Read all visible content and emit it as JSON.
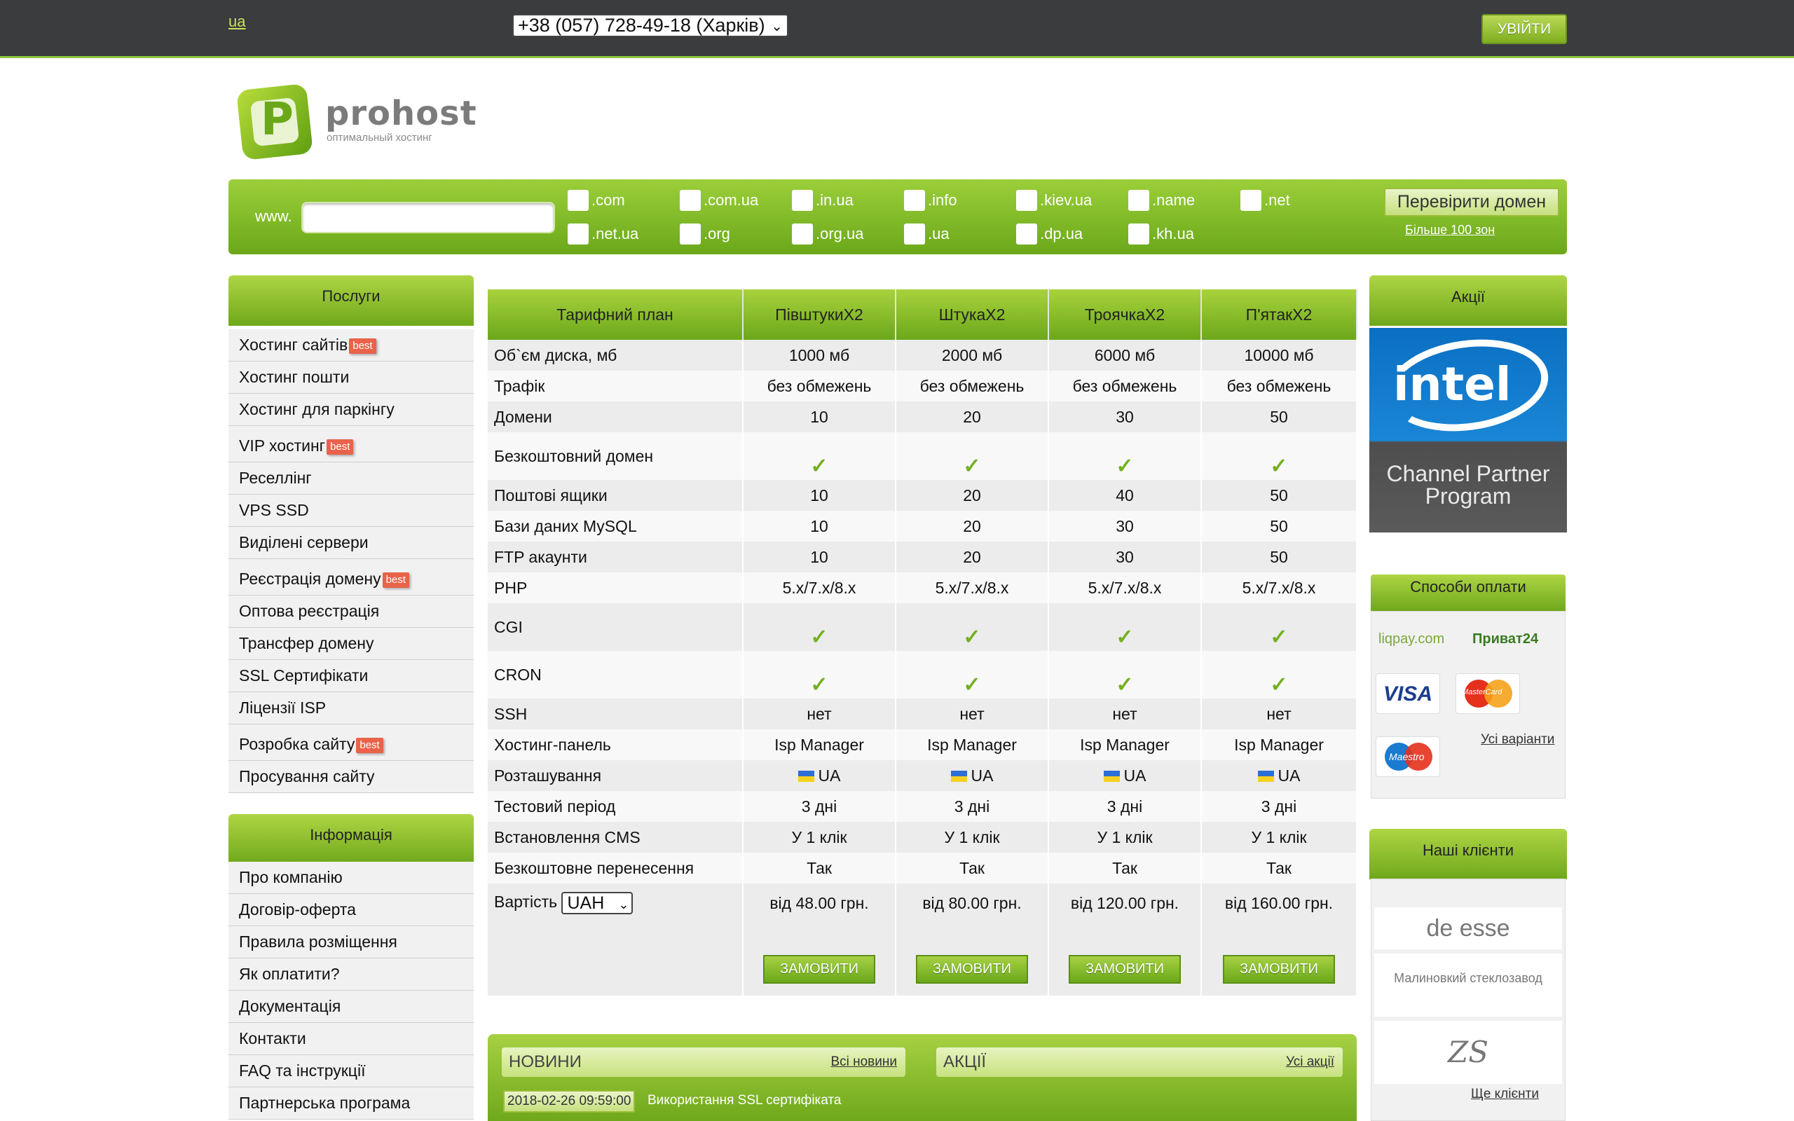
{
  "topbar": {
    "lang": "ua",
    "phone": "+38 (057) 728-49-18 (Харків)",
    "login": "УВІЙТИ"
  },
  "logo": {
    "name": "prohost",
    "tagline": "оптимальный хостинг"
  },
  "domain_search": {
    "prefix": "www.",
    "input_value": "",
    "zones_row1": [
      ".com",
      ".com.ua",
      ".in.ua",
      ".info",
      ".kiev.ua",
      ".name",
      ".net"
    ],
    "zones_row2": [
      ".net.ua",
      ".org",
      ".org.ua",
      ".ua",
      ".dp.ua",
      ".kh.ua"
    ],
    "check_button": "Перевірити домен",
    "more_zones": "Більше 100 зон"
  },
  "sidebar": {
    "services_title": "Послуги",
    "services": [
      {
        "label": "Хостинг сайтів",
        "badge": "best"
      },
      {
        "label": "Хостинг пошти",
        "badge": ""
      },
      {
        "label": "Хостинг для паркінгу",
        "badge": ""
      },
      {
        "label": "VIP хостинг",
        "badge": "best"
      },
      {
        "label": "Реселлінг",
        "badge": ""
      },
      {
        "label": "VPS SSD",
        "badge": ""
      },
      {
        "label": "Виділені сервери",
        "badge": ""
      },
      {
        "label": "Реєстрація домену",
        "badge": "best"
      },
      {
        "label": "Оптова реєстрація",
        "badge": ""
      },
      {
        "label": "Трансфер домену",
        "badge": ""
      },
      {
        "label": "SSL Сертифікати",
        "badge": ""
      },
      {
        "label": "Ліцензії ISP",
        "badge": ""
      },
      {
        "label": "Розробка сайту",
        "badge": "best"
      },
      {
        "label": "Просування сайту",
        "badge": ""
      }
    ],
    "info_title": "Інформація",
    "info": [
      "Про компанію",
      "Договір-оферта",
      "Правила розміщення",
      "Як оплатити?",
      "Документація",
      "Контакти",
      "FAQ та інструкції",
      "Партнерська програма"
    ]
  },
  "plans": {
    "header_label": "Тарифний план",
    "plan_names": [
      "ПівштукиX2",
      "ШтукаX2",
      "ТроячкаX2",
      "П'ятакX2"
    ],
    "rows": {
      "disk": {
        "label": "Об`єм диска, мб",
        "values": [
          "1000 мб",
          "2000 мб",
          "6000 мб",
          "10000 мб"
        ]
      },
      "traffic": {
        "label": "Трафік",
        "values": [
          "без обмежень",
          "без обмежень",
          "без обмежень",
          "без обмежень"
        ]
      },
      "domains": {
        "label": "Домени",
        "values": [
          "10",
          "20",
          "30",
          "50"
        ]
      },
      "free_domain": {
        "label": "Безкоштовний домен"
      },
      "mailboxes": {
        "label": "Поштові ящики",
        "values": [
          "10",
          "20",
          "40",
          "50"
        ]
      },
      "mysql": {
        "label": "Бази даних MySQL",
        "values": [
          "10",
          "20",
          "30",
          "50"
        ]
      },
      "ftp": {
        "label": "FTP акаунти",
        "values": [
          "10",
          "20",
          "30",
          "50"
        ]
      },
      "php": {
        "label": "PHP",
        "values": [
          "5.x/7.x/8.x",
          "5.x/7.x/8.x",
          "5.x/7.x/8.x",
          "5.x/7.x/8.x"
        ]
      },
      "cgi": {
        "label": "CGI"
      },
      "cron": {
        "label": "CRON"
      },
      "ssh": {
        "label": "SSH",
        "values": [
          "нет",
          "нет",
          "нет",
          "нет"
        ]
      },
      "panel": {
        "label": "Хостинг-панель",
        "values": [
          "Isp Manager",
          "Isp Manager",
          "Isp Manager",
          "Isp Manager"
        ]
      },
      "location": {
        "label": "Розташування",
        "values": [
          "UA",
          "UA",
          "UA",
          "UA"
        ]
      },
      "trial": {
        "label": "Тестовий період",
        "values": [
          "3 дні",
          "3 дні",
          "3 дні",
          "3 дні"
        ]
      },
      "cms": {
        "label": "Встановлення CMS",
        "values": [
          "У 1 клік",
          "У 1 клік",
          "У 1 клік",
          "У 1 клік"
        ]
      },
      "transfer": {
        "label": "Безкоштовне перенесення",
        "values": [
          "Так",
          "Так",
          "Так",
          "Так"
        ]
      },
      "price": {
        "label": "Вартість",
        "currency": "UAH",
        "values": [
          "від 48.00 грн.",
          "від 80.00 грн.",
          "від 120.00 грн.",
          "від 160.00 грн."
        ]
      }
    },
    "order_button": "ЗАМОВИТИ",
    "check_mark": "✓"
  },
  "news": {
    "news_title": "НОВИНИ",
    "all_news": "Всі новини",
    "promo_title": "АКЦІЇ",
    "all_promos": "Усі акції",
    "latest_date": "2018-02-26 09:59:00",
    "latest_title": "Використання SSL сертифіката"
  },
  "right": {
    "promo_title": "Акції",
    "intel_word": "intel",
    "intel_program": "Channel Partner Program",
    "payments_title": "Способи оплати",
    "payment_logos": [
      "liqpay.com",
      "Приват24",
      "VISA",
      "MasterCard",
      "Maestro"
    ],
    "all_variants": "Усі варіанти",
    "clients_title": "Наші клієнти",
    "clients": [
      "de esse",
      "Малиновкий стеклозавод",
      "ZS"
    ],
    "more_clients": "Ще клієнти"
  },
  "colors": {
    "accent_green": "#8dc63f",
    "topbar": "#3a3c3e",
    "best_badge": "#e9634a"
  }
}
